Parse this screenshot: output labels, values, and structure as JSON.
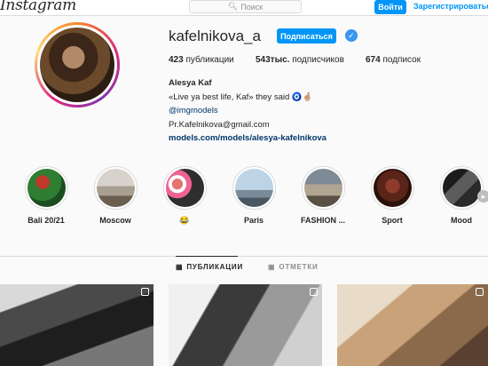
{
  "header": {
    "logo": "Instagram",
    "search_placeholder": "Поиск",
    "login_label": "Войти",
    "register_label": "Зарегистрироваться"
  },
  "profile": {
    "username": "kafelnikova_a",
    "follow_label": "Подписаться",
    "verified": true,
    "stats": {
      "posts_count": "423",
      "posts_label": "публикации",
      "followers_count": "543тыс.",
      "followers_label": "подписчиков",
      "following_count": "674",
      "following_label": "подписок"
    },
    "bio": {
      "full_name": "Alesya Kaf",
      "quote": "«Live ya best life, Kaf» they said 🧿🤞🏼",
      "mention": "@imgmodels",
      "email": "Pr.Kafelnikova@gmail.com",
      "website": "models.com/models/alesya-kafelnikova"
    }
  },
  "highlights": [
    {
      "label": "Bali 20/21"
    },
    {
      "label": "Moscow"
    },
    {
      "label": "😂"
    },
    {
      "label": "Paris"
    },
    {
      "label": "FASHION ..."
    },
    {
      "label": "Sport"
    },
    {
      "label": "Mood"
    }
  ],
  "tabs": [
    {
      "label": "ПУБЛИКАЦИИ",
      "active": true
    },
    {
      "label": "ОТМЕТКИ",
      "active": false
    }
  ],
  "colors": {
    "accent": "#0095f6",
    "link": "#00376b",
    "border": "#dbdbdb"
  }
}
